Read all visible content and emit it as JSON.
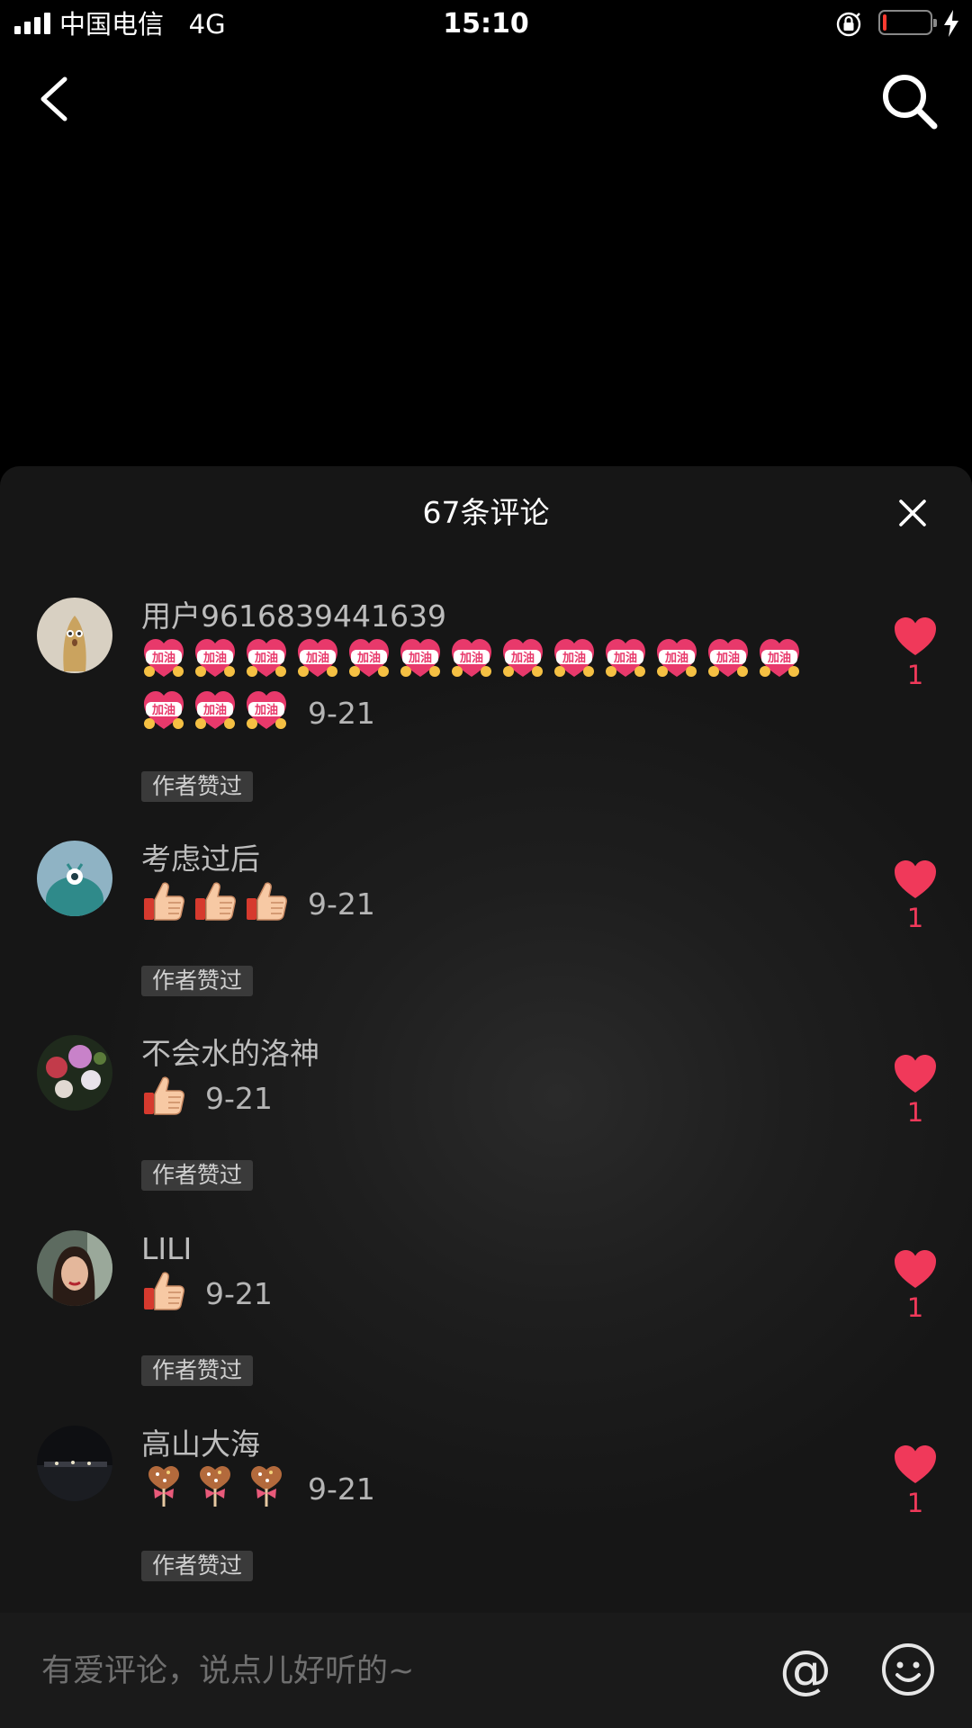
{
  "status_bar": {
    "carrier": "中国电信",
    "network": "4G",
    "time": "15:10",
    "battery_level": 0.08
  },
  "nav": {
    "back_icon": "chevron-left-icon",
    "search_icon": "search-icon"
  },
  "comments_panel": {
    "title": "67条评论",
    "close_icon": "close-icon",
    "accent_color": "#f0395a",
    "comments": [
      {
        "username": "用户9616839441639",
        "emoji": "加油",
        "emoji_count": 16,
        "date": "9-21",
        "badge": "作者赞过",
        "likes": "1"
      },
      {
        "username": "考虑过后",
        "emoji": "thumbs-up",
        "emoji_count": 3,
        "date": "9-21",
        "badge": "作者赞过",
        "likes": "1"
      },
      {
        "username": "不会水的洛神",
        "emoji": "thumbs-up",
        "emoji_count": 1,
        "date": "9-21",
        "badge": "作者赞过",
        "likes": "1"
      },
      {
        "username": "LILI",
        "emoji": "thumbs-up",
        "emoji_count": 1,
        "date": "9-21",
        "badge": "作者赞过",
        "likes": "1"
      },
      {
        "username": "高山大海",
        "emoji": "lollipop",
        "emoji_count": 3,
        "date": "9-21",
        "badge": "作者赞过",
        "likes": "1"
      }
    ]
  },
  "input_bar": {
    "placeholder": "有爱评论，说点儿好听的~",
    "mention_label": "@",
    "emoji_icon": "smiley-icon"
  }
}
